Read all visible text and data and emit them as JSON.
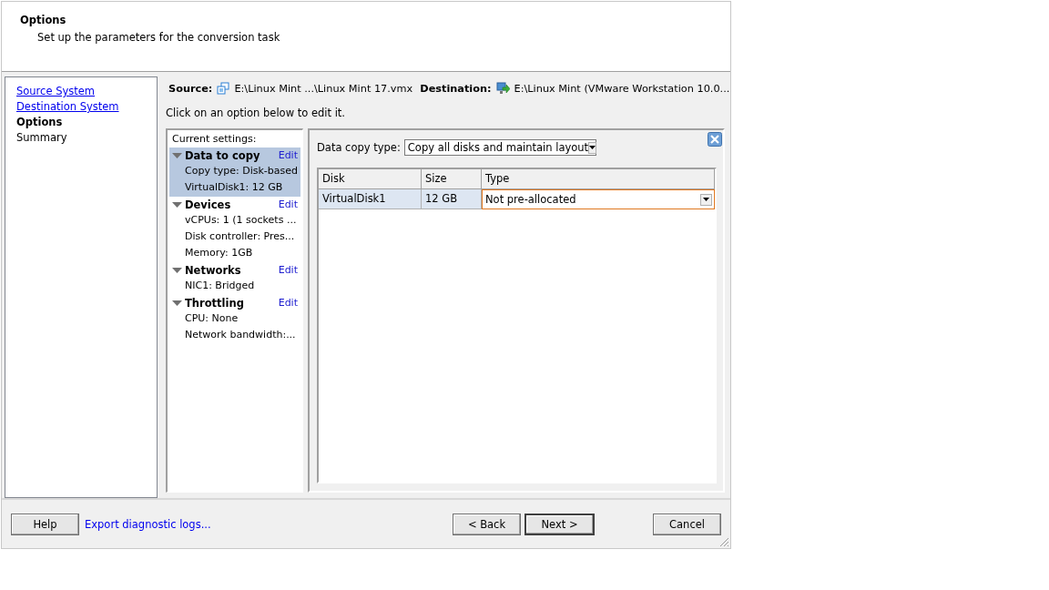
{
  "header": {
    "title": "Options",
    "subtitle": "Set up the parameters for the conversion task"
  },
  "nav": {
    "items": [
      {
        "label": "Source System",
        "kind": "link",
        "selected": false
      },
      {
        "label": "Destination System",
        "kind": "link",
        "selected": false
      },
      {
        "label": "Options",
        "kind": "step",
        "selected": true
      },
      {
        "label": "Summary",
        "kind": "step",
        "selected": false
      }
    ]
  },
  "summary": {
    "source_label": "Source:",
    "source_path": "E:\\Linux Mint ...\\Linux Mint 17.vmx",
    "destination_label": "Destination:",
    "destination_path": "E:\\Linux Mint (VMware Workstation 10.0...",
    "instruction": "Click on an option below to edit it."
  },
  "settings": {
    "heading": "Current settings:",
    "groups": [
      {
        "title": "Data to copy",
        "edit": "Edit",
        "expanded": true,
        "selected": true,
        "items": [
          "Copy type: Disk-based",
          "VirtualDisk1: 12 GB"
        ]
      },
      {
        "title": "Devices",
        "edit": "Edit",
        "expanded": true,
        "selected": false,
        "items": [
          "vCPUs: 1 (1 sockets ...",
          "Disk controller: Pres...",
          "Memory: 1GB"
        ]
      },
      {
        "title": "Networks",
        "edit": "Edit",
        "expanded": true,
        "selected": false,
        "items": [
          "NIC1: Bridged"
        ]
      },
      {
        "title": "Throttling",
        "edit": "Edit",
        "expanded": true,
        "selected": false,
        "items": [
          "CPU: None",
          "Network bandwidth:..."
        ]
      }
    ]
  },
  "detail": {
    "copy_type_label": "Data copy type:",
    "copy_type_value": "Copy all disks and maintain layout",
    "table": {
      "columns": [
        "Disk",
        "Size",
        "Type"
      ],
      "rows": [
        {
          "disk": "VirtualDisk1",
          "size": "12 GB",
          "type": "Not pre-allocated",
          "selected": true
        }
      ]
    }
  },
  "footer": {
    "help": "Help",
    "export_link": "Export diagnostic logs...",
    "back": "< Back",
    "next": "Next >",
    "cancel": "Cancel"
  }
}
